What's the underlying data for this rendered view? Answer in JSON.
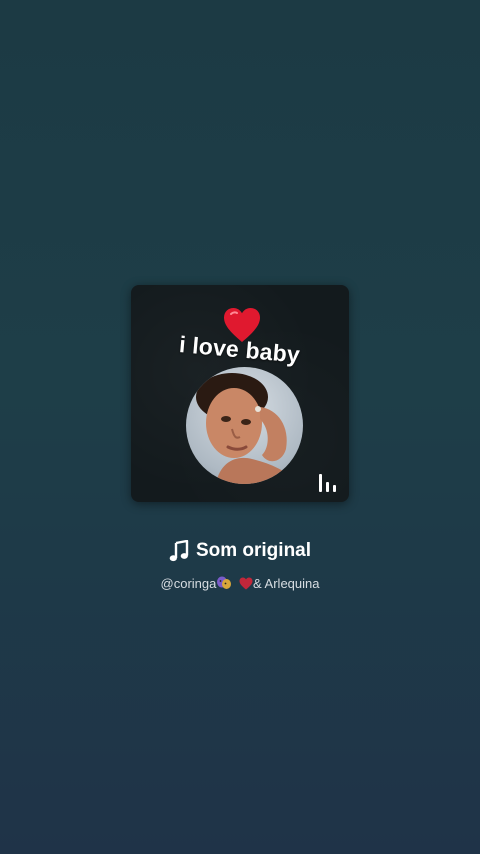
{
  "cover": {
    "text": "i love baby",
    "heart_color": "#e0192f"
  },
  "sound": {
    "title": "Som original",
    "creator_handle": "@coringa",
    "creator_suffix": "& Arlequina"
  },
  "icons": [
    "music-note-icon",
    "masks-emoji-icon",
    "heart-emoji-icon",
    "playing-bars-icon"
  ]
}
